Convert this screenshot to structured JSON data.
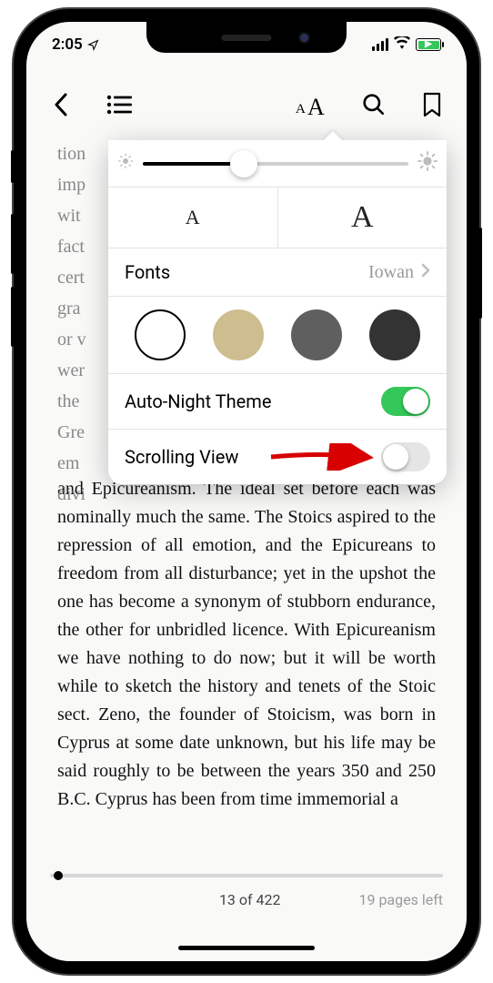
{
  "status": {
    "time": "2:05"
  },
  "toolbar": {
    "back": "back-chevron",
    "contents": "list-icon",
    "appearance": "font-size-icon",
    "search": "search-icon",
    "bookmark": "bookmark-icon"
  },
  "appearance_popover": {
    "brightness_percent": 38,
    "font_size_small": "A",
    "font_size_large": "A",
    "fonts_label": "Fonts",
    "fonts_value": "Iowan",
    "themes": [
      "white",
      "sepia",
      "gray",
      "dark"
    ],
    "selected_theme": "white",
    "auto_night_label": "Auto-Night Theme",
    "auto_night_on": true,
    "scrolling_label": "Scrolling View",
    "scrolling_on": false
  },
  "page_text_top": "tion\nimp\nwit\nfact\ncert\ngra\nor v\nwer\nthe\nGre\nem\ndivi",
  "page_text_body": "and Epicureanism. The ideal set before each was nominally much the same. The Stoics aspired to the repression of all emotion, and the Epicureans to freedom from all disturbance; yet in the upshot the one has become a synonym of stubborn endurance, the other for unbridled licence. With Epicureanism we have nothing to do now; but it will be worth while to sketch the history and tenets of the Stoic sect. Zeno, the founder of Stoicism, was born in Cyprus at some date unknown, but his life may be said roughly to be between the years 350 and 250 B.C. Cyprus has been from time immemorial a",
  "footer": {
    "page_current": 13,
    "page_total": 422,
    "page_display": "13 of 422",
    "pages_left": "19 pages left",
    "progress_percent": 2
  }
}
